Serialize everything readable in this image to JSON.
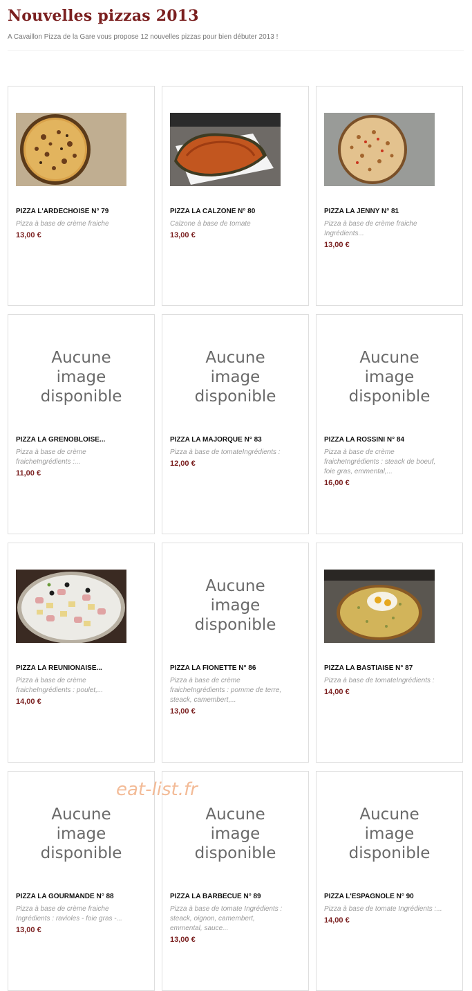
{
  "header": {
    "title": "Nouvelles pizzas 2013",
    "intro": "A Cavaillon Pizza de la Gare vous propose 12 nouvelles pizzas pour bien débuter 2013 !"
  },
  "no_image_label": [
    "Aucune",
    "image",
    "disponible"
  ],
  "products": [
    {
      "name": "PIZZA L'ARDECHOISE N° 79",
      "desc": [
        "Pizza à base de crème fraiche"
      ],
      "price": "13,00 €",
      "image": "pizza-ardechoise"
    },
    {
      "name": "PIZZA LA CALZONE N° 80",
      "desc": [
        "Calzone à base de tomate"
      ],
      "price": "13,00 €",
      "image": "pizza-calzone"
    },
    {
      "name": "PIZZA LA JENNY N° 81",
      "desc": [
        "Pizza à base de crème fraiche",
        "Ingrédients..."
      ],
      "price": "13,00 €",
      "image": "pizza-jenny"
    },
    {
      "name": "PIZZA LA GRENOBLOISE...",
      "desc": [
        "Pizza à base de crème",
        "fraicheIngrédients :..."
      ],
      "price": "11,00 €",
      "image": null
    },
    {
      "name": "PIZZA LA MAJORQUE N° 83",
      "desc": [
        "Pizza à base de tomateIngrédients :"
      ],
      "price": "12,00 €",
      "image": null
    },
    {
      "name": "PIZZA LA ROSSINI N° 84",
      "desc": [
        "Pizza à base de crème",
        "fraicheIngrédients : steack de boeuf,",
        "foie gras, emmental,..."
      ],
      "price": "16,00 €",
      "image": null
    },
    {
      "name": "PIZZA LA REUNIONAISE...",
      "desc": [
        "Pizza à base de crème",
        "fraicheIngrédients : poulet,..."
      ],
      "price": "14,00 €",
      "image": "pizza-reunionaise"
    },
    {
      "name": "PIZZA LA FIONETTE N° 86",
      "desc": [
        "Pizza à base de crème",
        "fraicheIngrédients : pomme de terre,",
        "steack, camembert,..."
      ],
      "price": "13,00 €",
      "image": null
    },
    {
      "name": "PIZZA LA BASTIAISE N° 87",
      "desc": [
        "Pizza à base de tomateIngrédients :"
      ],
      "price": "14,00 €",
      "image": "pizza-bastiaise"
    },
    {
      "name": "PIZZA LA GOURMANDE N° 88",
      "desc": [
        "Pizza à base de crème fraiche",
        "Ingrédients : ravioles - foie gras -..."
      ],
      "price": "13,00 €",
      "image": null
    },
    {
      "name": "PIZZA LA BARBECUE N° 89",
      "desc": [
        "Pizza à base de tomate Ingrédients :",
        "steack, oignon, camembert,",
        "emmental, sauce..."
      ],
      "price": "13,00 €",
      "image": null
    },
    {
      "name": "PIZZA L'ESPAGNOLE N° 90",
      "desc": [
        "Pizza à base de tomate Ingrédients :..."
      ],
      "price": "14,00 €",
      "image": null
    }
  ],
  "watermark": "eat-list.fr"
}
